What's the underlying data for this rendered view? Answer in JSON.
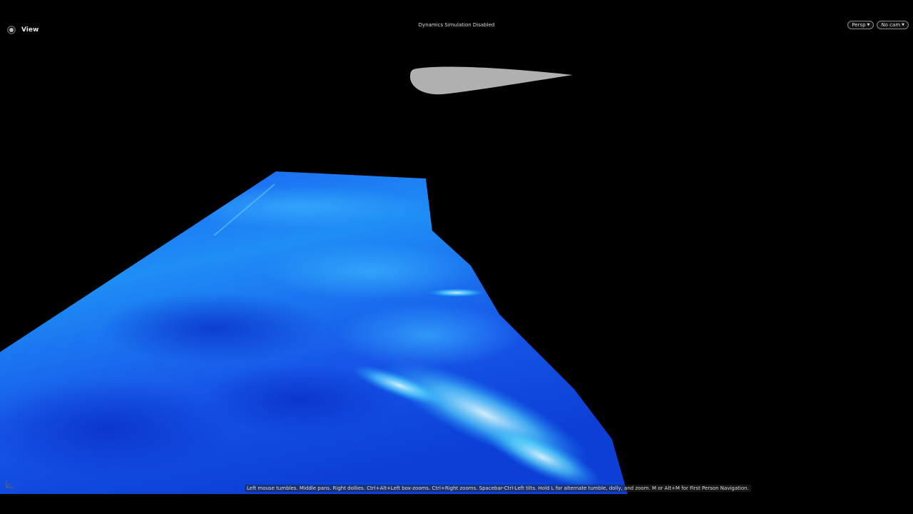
{
  "viewport": {
    "title": "View",
    "status": "Dynamics Simulation Disabled",
    "camera_buttons": [
      {
        "label": "Persp"
      },
      {
        "label": "No cam"
      }
    ],
    "navigation_hint": "Left mouse tumbles. Middle pans. Right dollies. Ctrl+Alt+Left box-zooms. Ctrl+Right zooms. Spacebar-Ctrl-Left tilts. Hold L for alternate tumble, dolly, and zoom. M or Alt+M for First Person Navigation."
  },
  "icons": {
    "view": "view-icon",
    "axis": "axis-gnomon-icon",
    "dropdown": "chevron-down-icon"
  },
  "colors": {
    "background": "#000000",
    "water_deep": "#0a3cd8",
    "water_mid": "#1f7ff0",
    "foam": "#d8ffff",
    "airfoil": "#b0b0b0"
  }
}
